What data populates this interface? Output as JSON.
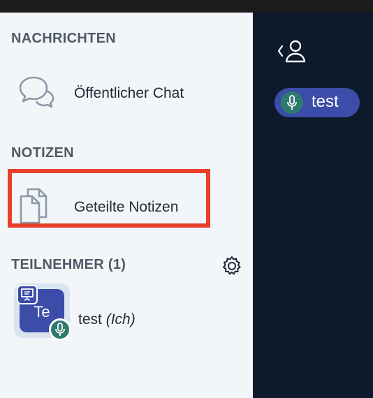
{
  "sections": {
    "messages": "NACHRICHTEN",
    "notes": "NOTIZEN",
    "participants": "TEILNEHMER (1)"
  },
  "items": {
    "public_chat": "Öffentlicher Chat",
    "shared_notes": "Geteilte Notizen"
  },
  "user": {
    "initials": "Te",
    "name": "test",
    "suffix": "(Ich)"
  },
  "talking": {
    "name": "test"
  },
  "icons": {
    "chat": "chat-bubbles-icon",
    "notes": "documents-icon",
    "settings": "gear-icon",
    "presenter": "presenter-icon",
    "mic": "microphone-icon",
    "back_user": "back-user-icon"
  },
  "colors": {
    "highlight": "#e8402a",
    "avatar": "#3b4da8",
    "mic": "#2f7a6e",
    "dark_panel": "#0c1a2b"
  }
}
